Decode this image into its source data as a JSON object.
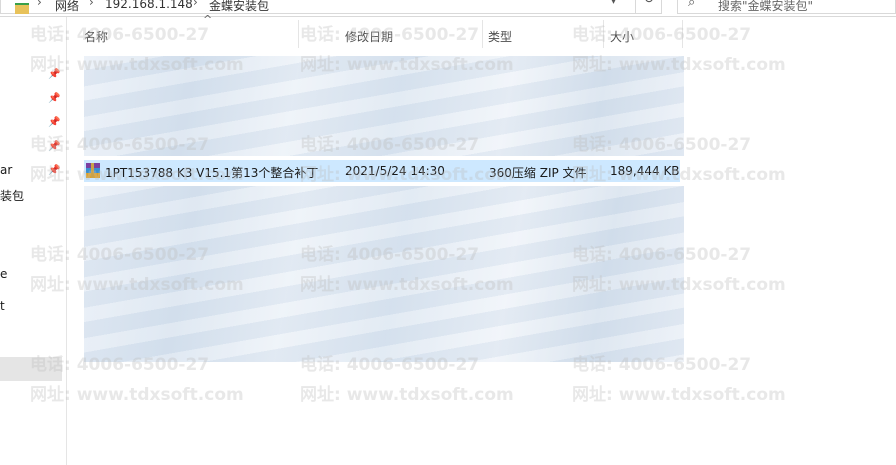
{
  "address_bar": {
    "segments": [
      "网络",
      "192.168.1.148",
      "金蝶安装包"
    ],
    "search_placeholder": "搜索\"金蝶安装包\""
  },
  "nav": {
    "labels": [
      "ar",
      "装包",
      "e",
      "t"
    ]
  },
  "columns": {
    "name": "名称",
    "modified": "修改日期",
    "type": "类型",
    "size": "大小"
  },
  "file": {
    "name": "1PT153788 K3 V15.1第13个整合补丁",
    "modified": "2021/5/24 14:30",
    "type": "360压缩 ZIP 文件",
    "size": "189,444 KB"
  },
  "watermark": {
    "phone": "电话: 4006-6500-27",
    "site": "网址: www.tdxsoft.com"
  }
}
